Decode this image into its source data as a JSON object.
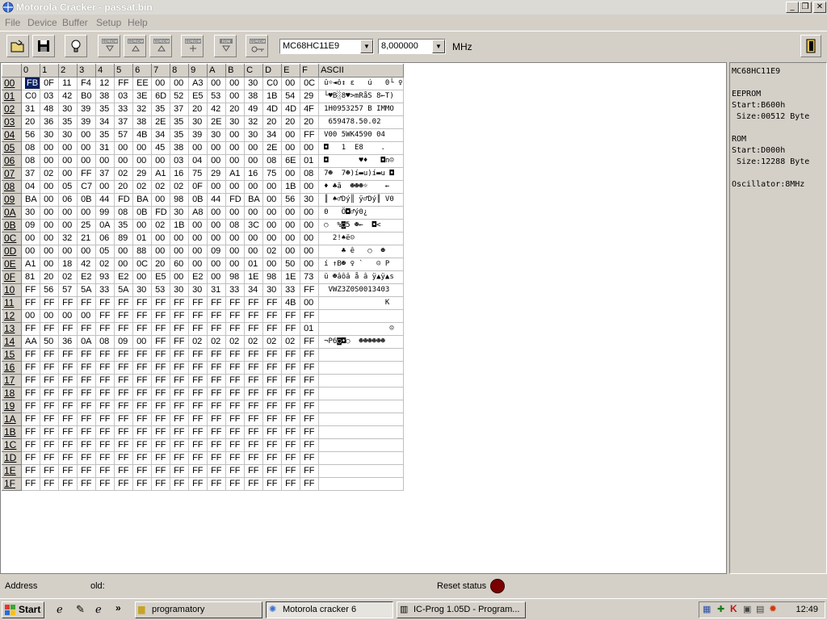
{
  "window": {
    "title": "Motorola Cracker - passat.bin"
  },
  "menu": [
    "File",
    "Device",
    "Buffer",
    "Setup",
    "Help"
  ],
  "toolbar": {
    "chip_select": "MC68HC11E9",
    "freq_select": "8,000000",
    "freq_unit": "MHz",
    "btn_labels": [
      "EEPROM",
      "EEPROM",
      "EEPROM",
      "EEPROM",
      "ROM",
      "EEPROM"
    ]
  },
  "hex": {
    "columns": [
      "0",
      "1",
      "2",
      "3",
      "4",
      "5",
      "6",
      "7",
      "8",
      "9",
      "A",
      "B",
      "C",
      "D",
      "E",
      "F"
    ],
    "ascii_header": "ASCII",
    "rows": [
      {
        "addr": "00",
        "bytes": [
          "FB",
          "0F",
          "11",
          "F4",
          "12",
          "FF",
          "EE",
          "00",
          "00",
          "A3",
          "00",
          "00",
          "30",
          "C0",
          "00",
          "0C"
        ],
        "ascii": "û☼◄ô↕ ε   ú   0└ ♀"
      },
      {
        "addr": "01",
        "bytes": [
          "C0",
          "03",
          "42",
          "B0",
          "38",
          "03",
          "3E",
          "6D",
          "52",
          "E5",
          "53",
          "00",
          "38",
          "1B",
          "54",
          "29"
        ],
        "ascii": "└♥B░8♥>mRåS 8←T)"
      },
      {
        "addr": "02",
        "bytes": [
          "31",
          "48",
          "30",
          "39",
          "35",
          "33",
          "32",
          "35",
          "37",
          "20",
          "42",
          "20",
          "49",
          "4D",
          "4D",
          "4F"
        ],
        "ascii": "1H0953257 B IMMO"
      },
      {
        "addr": "03",
        "bytes": [
          "20",
          "36",
          "35",
          "39",
          "34",
          "37",
          "38",
          "2E",
          "35",
          "30",
          "2E",
          "30",
          "32",
          "20",
          "20",
          "20"
        ],
        "ascii": " 659478.50.02   "
      },
      {
        "addr": "04",
        "bytes": [
          "56",
          "30",
          "30",
          "00",
          "35",
          "57",
          "4B",
          "34",
          "35",
          "39",
          "30",
          "00",
          "30",
          "34",
          "00",
          "FF"
        ],
        "ascii": "V00 5WK4590 04  "
      },
      {
        "addr": "05",
        "bytes": [
          "08",
          "00",
          "00",
          "00",
          "31",
          "00",
          "00",
          "45",
          "38",
          "00",
          "00",
          "00",
          "00",
          "2E",
          "00",
          "00"
        ],
        "ascii": "◘   1  E8    .  "
      },
      {
        "addr": "06",
        "bytes": [
          "08",
          "00",
          "00",
          "00",
          "00",
          "00",
          "00",
          "00",
          "03",
          "04",
          "00",
          "00",
          "00",
          "08",
          "6E",
          "01"
        ],
        "ascii": "◘       ♥♦   ◘n☺"
      },
      {
        "addr": "07",
        "bytes": [
          "37",
          "02",
          "00",
          "FF",
          "37",
          "02",
          "29",
          "A1",
          "16",
          "75",
          "29",
          "A1",
          "16",
          "75",
          "00",
          "08"
        ],
        "ascii": "7☻  7☻)í▬u)í▬u ◘"
      },
      {
        "addr": "08",
        "bytes": [
          "04",
          "00",
          "05",
          "C7",
          "00",
          "20",
          "02",
          "02",
          "02",
          "0F",
          "00",
          "00",
          "00",
          "00",
          "1B",
          "00"
        ],
        "ascii": "♦ ♣ã  ☻☻☻☼    ← "
      },
      {
        "addr": "09",
        "bytes": [
          "BA",
          "00",
          "06",
          "0B",
          "44",
          "FD",
          "BA",
          "00",
          "98",
          "0B",
          "44",
          "FD",
          "BA",
          "00",
          "56",
          "30"
        ],
        "ascii": "║ ♠♂Dý║ ÿ♂Dý║ V0"
      },
      {
        "addr": "0A",
        "bytes": [
          "30",
          "00",
          "00",
          "00",
          "99",
          "08",
          "0B",
          "FD",
          "30",
          "A8",
          "00",
          "00",
          "00",
          "00",
          "00",
          "00"
        ],
        "ascii": "0   Ö◘♂ý0¿      "
      },
      {
        "addr": "0B",
        "bytes": [
          "09",
          "00",
          "00",
          "25",
          "0A",
          "35",
          "00",
          "02",
          "1B",
          "00",
          "00",
          "08",
          "3C",
          "00",
          "00",
          "00"
        ],
        "ascii": "○  %◙5 ☻←  ◘<   "
      },
      {
        "addr": "0C",
        "bytes": [
          "00",
          "00",
          "32",
          "21",
          "06",
          "89",
          "01",
          "00",
          "00",
          "00",
          "00",
          "00",
          "00",
          "00",
          "00",
          "00"
        ],
        "ascii": "  2!♠ë☺         "
      },
      {
        "addr": "0D",
        "bytes": [
          "00",
          "00",
          "00",
          "00",
          "05",
          "00",
          "88",
          "00",
          "00",
          "00",
          "09",
          "00",
          "00",
          "02",
          "00",
          "00"
        ],
        "ascii": "    ♣ ê   ○  ☻  "
      },
      {
        "addr": "0E",
        "bytes": [
          "A1",
          "00",
          "18",
          "42",
          "02",
          "00",
          "0C",
          "20",
          "60",
          "00",
          "00",
          "00",
          "01",
          "00",
          "50",
          "00"
        ],
        "ascii": "í ↑B☻ ♀ `   ☺ P "
      },
      {
        "addr": "0F",
        "bytes": [
          "81",
          "20",
          "02",
          "E2",
          "93",
          "E2",
          "00",
          "E5",
          "00",
          "E2",
          "00",
          "98",
          "1E",
          "98",
          "1E",
          "73"
        ],
        "ascii": "ü ☻âôâ å â ÿ▲ÿ▲s"
      },
      {
        "addr": "10",
        "bytes": [
          "FF",
          "56",
          "57",
          "5A",
          "33",
          "5A",
          "30",
          "53",
          "30",
          "30",
          "31",
          "33",
          "34",
          "30",
          "33",
          "FF"
        ],
        "ascii": " VWZ3Z0S0013403 "
      },
      {
        "addr": "11",
        "bytes": [
          "FF",
          "FF",
          "FF",
          "FF",
          "FF",
          "FF",
          "FF",
          "FF",
          "FF",
          "FF",
          "FF",
          "FF",
          "FF",
          "FF",
          "4B",
          "00"
        ],
        "ascii": "              K "
      },
      {
        "addr": "12",
        "bytes": [
          "00",
          "00",
          "00",
          "00",
          "FF",
          "FF",
          "FF",
          "FF",
          "FF",
          "FF",
          "FF",
          "FF",
          "FF",
          "FF",
          "FF",
          "FF"
        ],
        "ascii": "                "
      },
      {
        "addr": "13",
        "bytes": [
          "FF",
          "FF",
          "FF",
          "FF",
          "FF",
          "FF",
          "FF",
          "FF",
          "FF",
          "FF",
          "FF",
          "FF",
          "FF",
          "FF",
          "FF",
          "01"
        ],
        "ascii": "               ☺"
      },
      {
        "addr": "14",
        "bytes": [
          "AA",
          "50",
          "36",
          "0A",
          "08",
          "09",
          "00",
          "FF",
          "FF",
          "02",
          "02",
          "02",
          "02",
          "02",
          "02",
          "FF"
        ],
        "ascii": "¬P6◙◘○  ☻☻☻☻☻☻ "
      },
      {
        "addr": "15",
        "bytes": [
          "FF",
          "FF",
          "FF",
          "FF",
          "FF",
          "FF",
          "FF",
          "FF",
          "FF",
          "FF",
          "FF",
          "FF",
          "FF",
          "FF",
          "FF",
          "FF"
        ],
        "ascii": ""
      },
      {
        "addr": "16",
        "bytes": [
          "FF",
          "FF",
          "FF",
          "FF",
          "FF",
          "FF",
          "FF",
          "FF",
          "FF",
          "FF",
          "FF",
          "FF",
          "FF",
          "FF",
          "FF",
          "FF"
        ],
        "ascii": ""
      },
      {
        "addr": "17",
        "bytes": [
          "FF",
          "FF",
          "FF",
          "FF",
          "FF",
          "FF",
          "FF",
          "FF",
          "FF",
          "FF",
          "FF",
          "FF",
          "FF",
          "FF",
          "FF",
          "FF"
        ],
        "ascii": ""
      },
      {
        "addr": "18",
        "bytes": [
          "FF",
          "FF",
          "FF",
          "FF",
          "FF",
          "FF",
          "FF",
          "FF",
          "FF",
          "FF",
          "FF",
          "FF",
          "FF",
          "FF",
          "FF",
          "FF"
        ],
        "ascii": ""
      },
      {
        "addr": "19",
        "bytes": [
          "FF",
          "FF",
          "FF",
          "FF",
          "FF",
          "FF",
          "FF",
          "FF",
          "FF",
          "FF",
          "FF",
          "FF",
          "FF",
          "FF",
          "FF",
          "FF"
        ],
        "ascii": ""
      },
      {
        "addr": "1A",
        "bytes": [
          "FF",
          "FF",
          "FF",
          "FF",
          "FF",
          "FF",
          "FF",
          "FF",
          "FF",
          "FF",
          "FF",
          "FF",
          "FF",
          "FF",
          "FF",
          "FF"
        ],
        "ascii": ""
      },
      {
        "addr": "1B",
        "bytes": [
          "FF",
          "FF",
          "FF",
          "FF",
          "FF",
          "FF",
          "FF",
          "FF",
          "FF",
          "FF",
          "FF",
          "FF",
          "FF",
          "FF",
          "FF",
          "FF"
        ],
        "ascii": ""
      },
      {
        "addr": "1C",
        "bytes": [
          "FF",
          "FF",
          "FF",
          "FF",
          "FF",
          "FF",
          "FF",
          "FF",
          "FF",
          "FF",
          "FF",
          "FF",
          "FF",
          "FF",
          "FF",
          "FF"
        ],
        "ascii": ""
      },
      {
        "addr": "1D",
        "bytes": [
          "FF",
          "FF",
          "FF",
          "FF",
          "FF",
          "FF",
          "FF",
          "FF",
          "FF",
          "FF",
          "FF",
          "FF",
          "FF",
          "FF",
          "FF",
          "FF"
        ],
        "ascii": ""
      },
      {
        "addr": "1E",
        "bytes": [
          "FF",
          "FF",
          "FF",
          "FF",
          "FF",
          "FF",
          "FF",
          "FF",
          "FF",
          "FF",
          "FF",
          "FF",
          "FF",
          "FF",
          "FF",
          "FF"
        ],
        "ascii": ""
      },
      {
        "addr": "1F",
        "bytes": [
          "FF",
          "FF",
          "FF",
          "FF",
          "FF",
          "FF",
          "FF",
          "FF",
          "FF",
          "FF",
          "FF",
          "FF",
          "FF",
          "FF",
          "FF",
          "FF"
        ],
        "ascii": ""
      }
    ]
  },
  "info": {
    "lines": [
      "MC68HC11E9",
      "",
      "EEPROM",
      "Start:B600h",
      " Size:00512 Byte",
      "",
      "ROM",
      "Start:D000h",
      " Size:12288 Byte",
      "",
      "Oscillator:8MHz"
    ]
  },
  "status": {
    "address_label": "Address",
    "old_label": "old:",
    "reset_label": "Reset status",
    "reset_color": "#7a0000"
  },
  "taskbar": {
    "start_label": "Start",
    "tasks": [
      "programatory",
      "Motorola cracker 6",
      "IC-Prog 1.05D - Program..."
    ],
    "clock": "12:49"
  }
}
